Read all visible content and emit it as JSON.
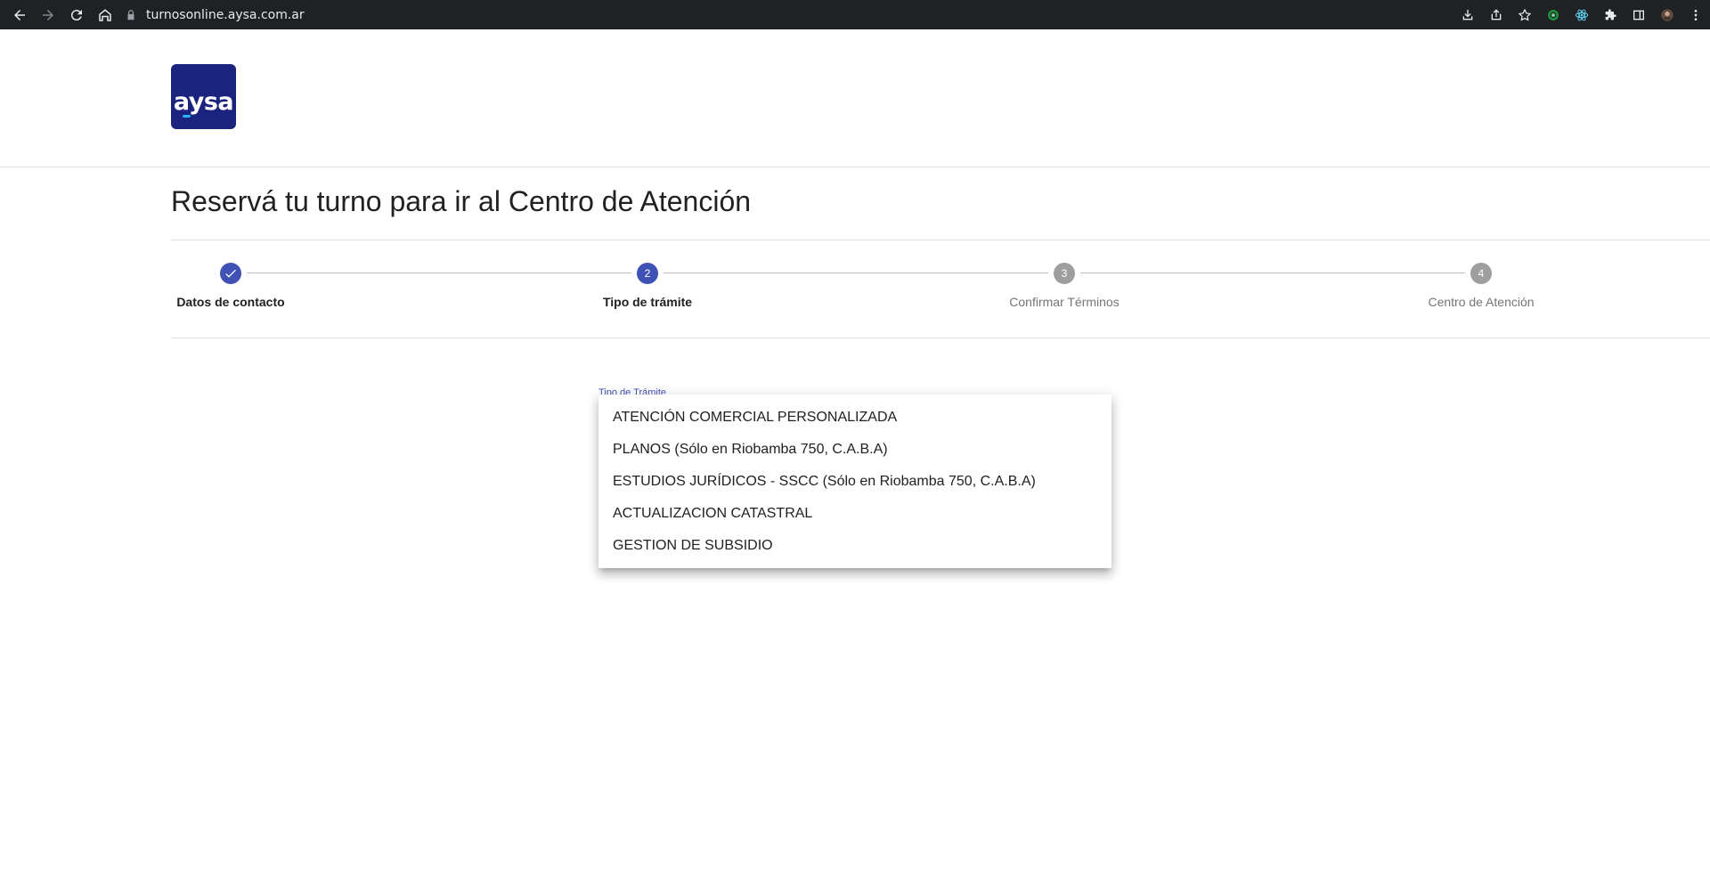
{
  "browser": {
    "url": "turnosonline.aysa.com.ar",
    "nav_icons": [
      "back-arrow-icon",
      "forward-arrow-icon",
      "reload-icon",
      "home-icon"
    ],
    "right_icons": [
      "install-icon",
      "share-icon",
      "bookmark-star-icon",
      "extension-green-icon",
      "extension-react-icon",
      "puzzle-extensions-icon",
      "side-panel-icon",
      "profile-avatar",
      "kebab-menu-icon"
    ]
  },
  "logo": {
    "text": "aysa"
  },
  "page": {
    "title": "Reservá tu turno para ir al Centro de Atención"
  },
  "stepper": {
    "steps": [
      {
        "label": "Datos de contacto",
        "state": "done",
        "number": ""
      },
      {
        "label": "Tipo de trámite",
        "state": "active",
        "number": "2"
      },
      {
        "label": "Confirmar Términos",
        "state": "pending",
        "number": "3"
      },
      {
        "label": "Centro de Atención",
        "state": "pending",
        "number": "4"
      }
    ]
  },
  "select": {
    "label": "Tipo de Trámite",
    "options": [
      "ATENCIÓN COMERCIAL PERSONALIZADA",
      "PLANOS (Sólo en Riobamba 750, C.A.B.A)",
      "ESTUDIOS JURÍDICOS - SSCC (Sólo en Riobamba 750, C.A.B.A)",
      "ACTUALIZACION CATASTRAL",
      "GESTION DE SUBSIDIO"
    ]
  },
  "colors": {
    "primary": "#3f51b5",
    "logo_bg": "#1a237e",
    "chrome_bg": "#202124",
    "pending": "#9e9e9e"
  }
}
